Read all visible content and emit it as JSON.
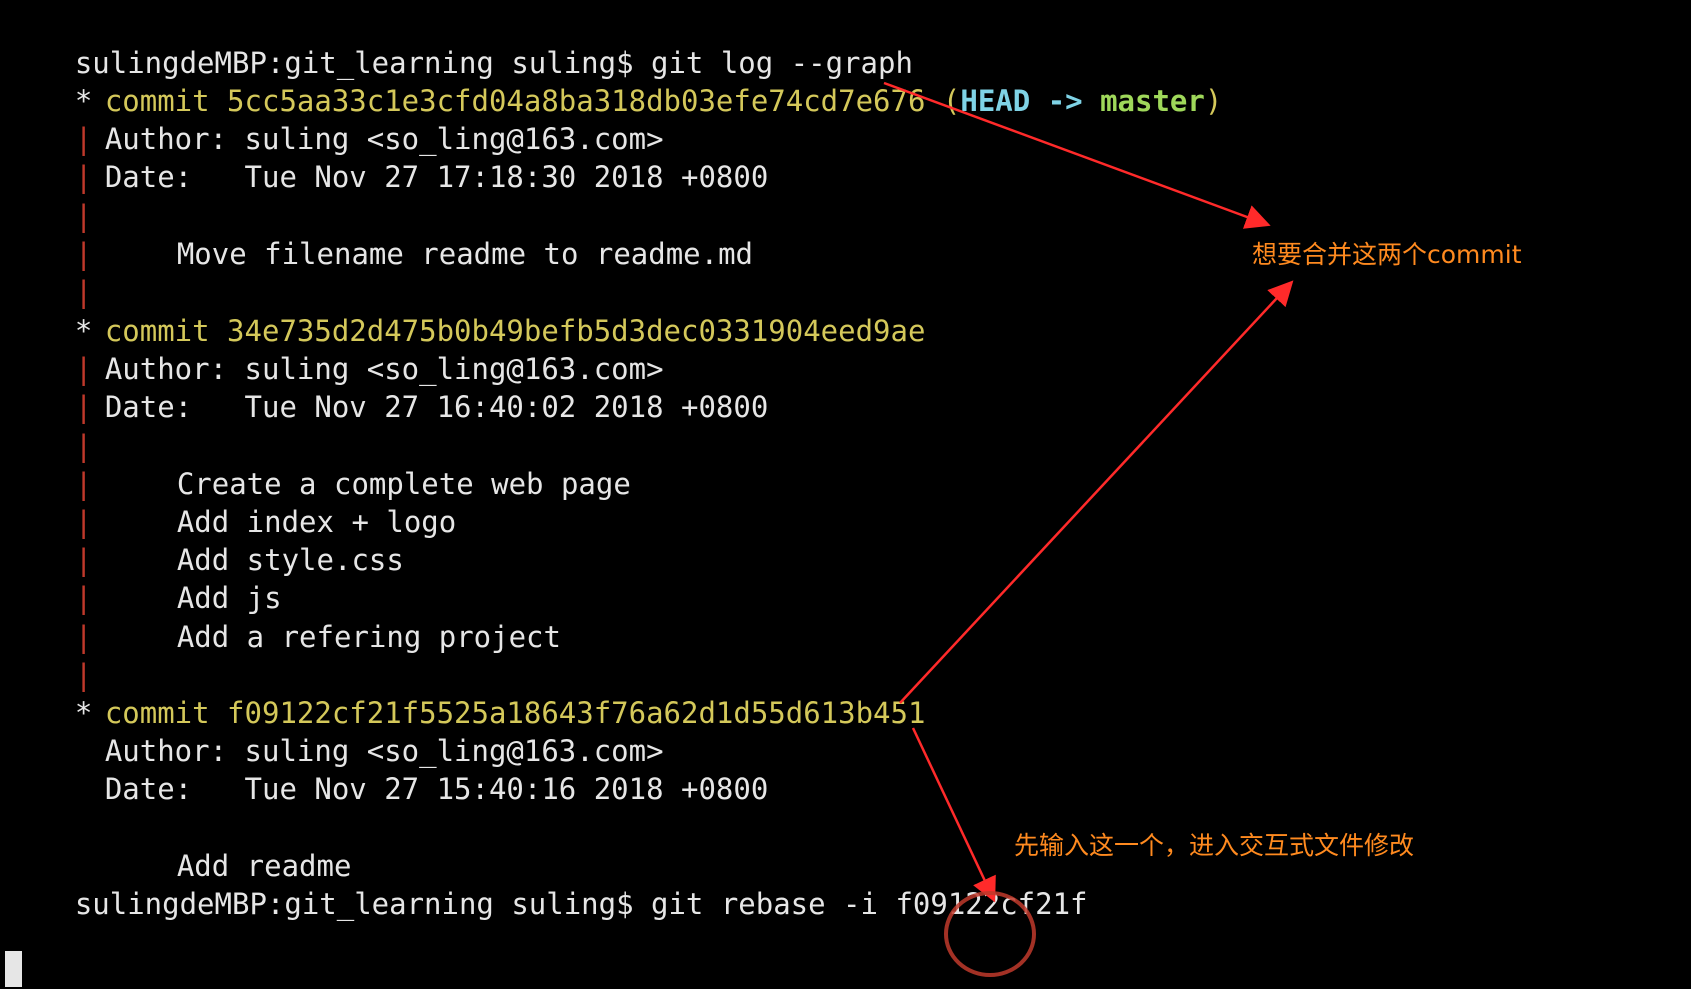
{
  "terminal": {
    "prompt1": "sulingdeMBP:git_learning suling$ git log --graph",
    "commits": [
      {
        "hash_line": "commit 5cc5aa33c1e3cfd04a8ba318db03efe74cd7e676",
        "ref_open": "(",
        "ref_head": "HEAD ->",
        "ref_branch": "master",
        "ref_close": ")",
        "author": "Author: suling <so_ling@163.com>",
        "date": "Date:   Tue Nov 27 17:18:30 2018 +0800",
        "messages": [
          "Move filename readme to readme.md"
        ]
      },
      {
        "hash_line": "commit 34e735d2d475b0b49befb5d3dec0331904eed9ae",
        "author": "Author: suling <so_ling@163.com>",
        "date": "Date:   Tue Nov 27 16:40:02 2018 +0800",
        "messages": [
          "Create a complete web page",
          "Add index + logo",
          "Add style.css",
          "Add js",
          "Add a refering project"
        ]
      },
      {
        "hash_line": "commit f09122cf21f5525a18643f76a62d1d55d613b451",
        "author": "Author: suling <so_ling@163.com>",
        "date": "Date:   Tue Nov 27 15:40:16 2018 +0800",
        "messages": [
          "Add readme"
        ]
      }
    ],
    "graph_star": "*",
    "graph_bar": "|",
    "prompt2": "sulingdeMBP:git_learning suling$ git rebase -i f09122cf21f"
  },
  "annotations": {
    "merge_note": "想要合并这两个commit",
    "rebase_note": "先输入这一个，进入交互式文件修改"
  },
  "colors": {
    "background": "#000000",
    "text": "#e6e6e6",
    "commit_hash": "#d4c85a",
    "head": "#7fd3e6",
    "branch": "#9fd85a",
    "graph_bar": "#c0392b",
    "annotation_text": "#ff8a1f",
    "annotation_arrow": "#ff2a2a"
  }
}
